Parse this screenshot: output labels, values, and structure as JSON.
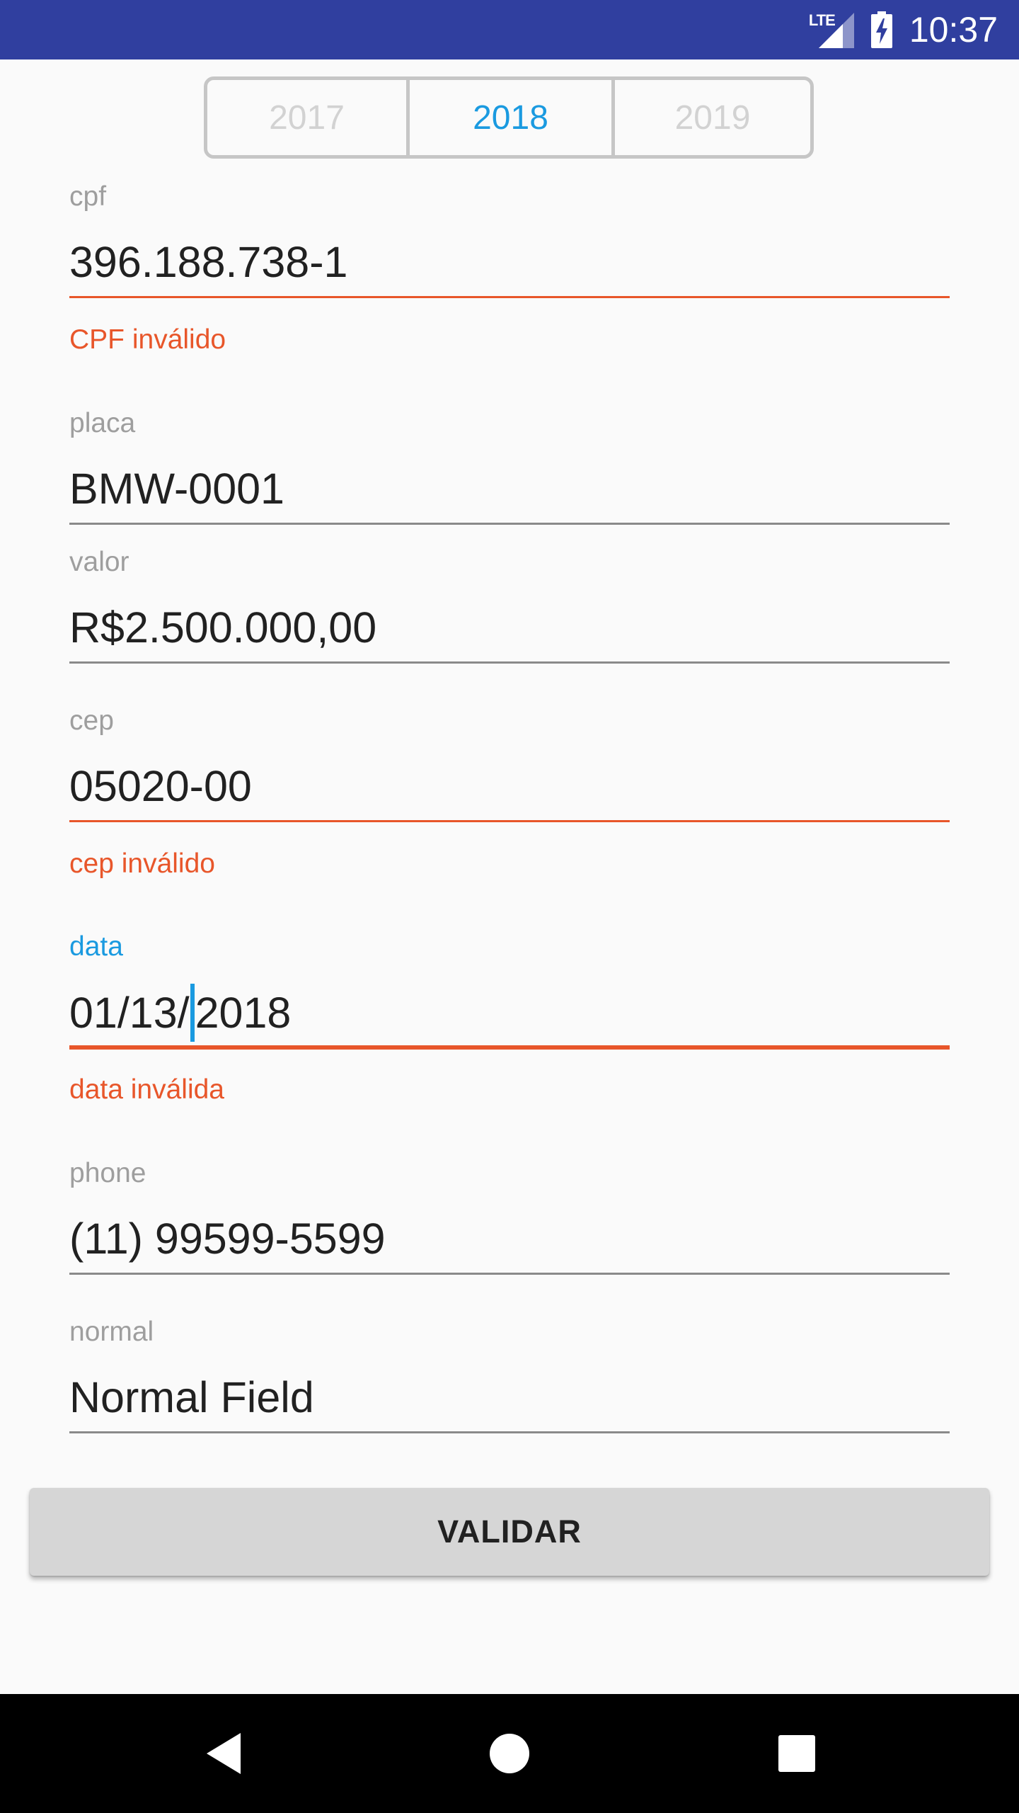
{
  "status_bar": {
    "network_label": "LTE",
    "time": "10:37",
    "icons": [
      "lte-signal-icon",
      "battery-charging-icon"
    ]
  },
  "year_selector": {
    "options": [
      "2017",
      "2018",
      "2019"
    ],
    "selected": "2018"
  },
  "form": {
    "cpf": {
      "label": "cpf",
      "value": "396.188.738-1",
      "error": "CPF inválido"
    },
    "placa": {
      "label": "placa",
      "value": "BMW-0001"
    },
    "valor": {
      "label": "valor",
      "value": "R$2.500.000,00"
    },
    "cep": {
      "label": "cep",
      "value": "05020-00",
      "error": "cep inválido"
    },
    "data": {
      "label": "data",
      "value_before_cursor": "01/13/",
      "value_after_cursor": "2018",
      "error": "data inválida"
    },
    "phone": {
      "label": "phone",
      "value": "(11) 99599-5599"
    },
    "normal": {
      "label": "normal",
      "value": "Normal Field"
    }
  },
  "actions": {
    "validate_label": "VALIDAR"
  },
  "navigation": {
    "icons": [
      "back-icon",
      "home-icon",
      "recents-icon"
    ]
  },
  "colors": {
    "status_bar": "#303f9f",
    "accent": "#1a9ae0",
    "error": "#e8562a",
    "background": "#fafafa",
    "button": "#d6d6d6"
  }
}
